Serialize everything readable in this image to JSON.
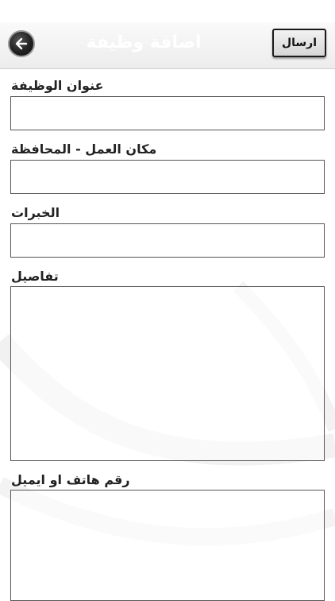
{
  "navbar": {
    "title": "اضافة وظيفة",
    "send_label": "ارسال",
    "back_icon": "arrow-left-icon"
  },
  "form": {
    "job_title_label": "عنوان الوظيفة",
    "location_label": "مكان العمل - المحافظة",
    "experience_label": "الخبرات",
    "details_label": "تفاصيل",
    "contact_label": "رقم هاتف او ايميل"
  }
}
